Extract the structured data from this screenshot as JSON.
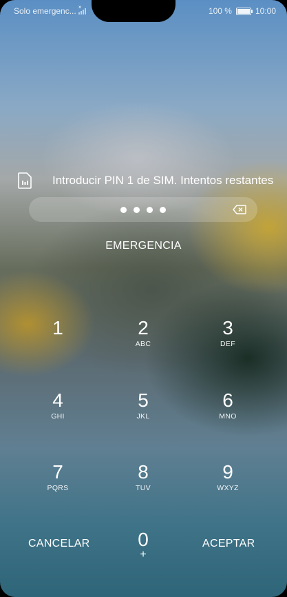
{
  "status_bar": {
    "carrier": "Solo emergenc...",
    "battery_percent": "100 %",
    "time": "10:00"
  },
  "pin_prompt": {
    "label": "Introducir PIN 1 de SIM. Intentos restantes",
    "entered_digits_count": 4
  },
  "emergency_label": "EMERGENCIA",
  "keypad": {
    "keys": [
      {
        "num": "1",
        "letters": ""
      },
      {
        "num": "2",
        "letters": "ABC"
      },
      {
        "num": "3",
        "letters": "DEF"
      },
      {
        "num": "4",
        "letters": "GHI"
      },
      {
        "num": "5",
        "letters": "JKL"
      },
      {
        "num": "6",
        "letters": "MNO"
      },
      {
        "num": "7",
        "letters": "PQRS"
      },
      {
        "num": "8",
        "letters": "TUV"
      },
      {
        "num": "9",
        "letters": "WXYZ"
      },
      {
        "num": "0",
        "letters": "+"
      }
    ],
    "cancel_label": "CANCELAR",
    "accept_label": "ACEPTAR"
  },
  "icons": {
    "sim": "sim-card-icon",
    "backspace": "backspace-icon",
    "signal": "no-signal-icon",
    "battery": "battery-full-icon"
  }
}
